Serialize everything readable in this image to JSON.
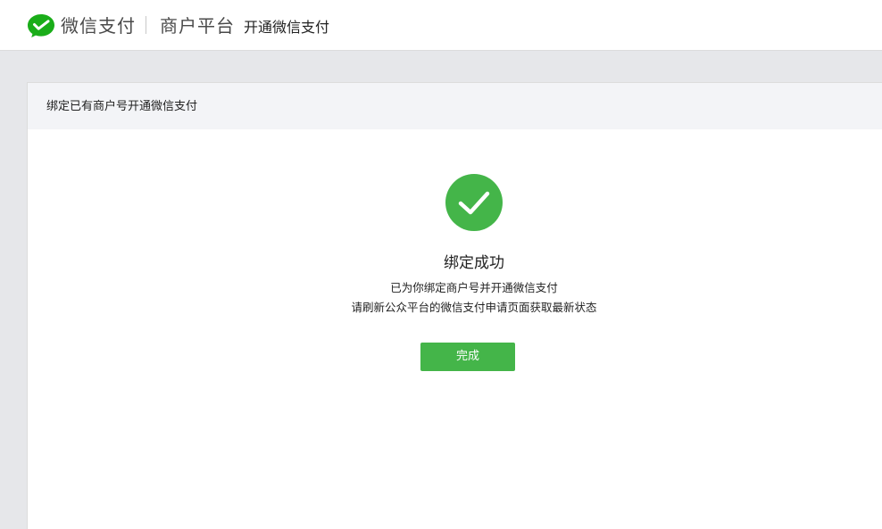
{
  "header": {
    "brand": "微信支付",
    "platform": "商户平台",
    "subtitle": "开通微信支付",
    "logo_icon": "wechat-pay-logo-icon",
    "brand_color": "#1aad19"
  },
  "panel": {
    "title": "绑定已有商户号开通微信支付"
  },
  "result": {
    "icon": "success-check-icon",
    "icon_color": "#44b549",
    "title": "绑定成功",
    "message_line1": "已为你绑定商户号并开通微信支付",
    "message_line2": "请刷新公众平台的微信支付申请页面获取最新状态",
    "done_button": "完成",
    "button_color": "#44b549"
  }
}
